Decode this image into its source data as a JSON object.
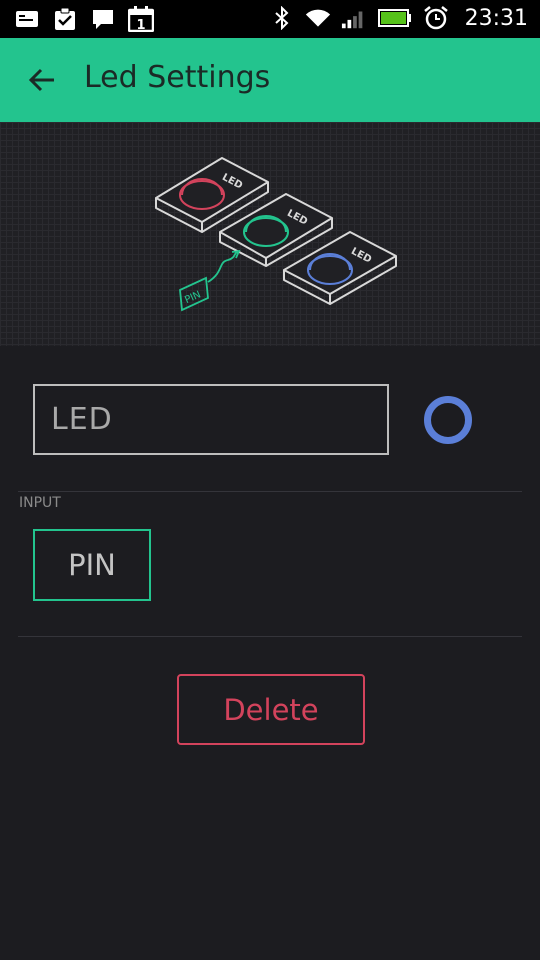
{
  "status_bar": {
    "time": "23:31",
    "left_icons": [
      "mail-icon",
      "clipboard-check-icon",
      "chat-icon",
      "calendar-icon"
    ],
    "calendar_day": "1",
    "right_icons": [
      "bluetooth-icon",
      "wifi-icon",
      "signal-icon",
      "battery-icon",
      "alarm-icon"
    ]
  },
  "app_bar": {
    "title": "Led Settings",
    "back_icon": "arrow-left-icon",
    "color": "#23c48e"
  },
  "illustration": {
    "modules": [
      {
        "label": "LED",
        "color": "#d3435c"
      },
      {
        "label": "LED",
        "color": "#23c48e"
      },
      {
        "label": "LED",
        "color": "#5b7fd8"
      }
    ],
    "pin_label": "PIN"
  },
  "widget": {
    "name_value": "LED",
    "color": "#5b7fd8"
  },
  "input_section": {
    "label": "INPUT",
    "pin_button": "PIN"
  },
  "actions": {
    "delete_label": "Delete",
    "delete_color": "#d3435c"
  }
}
